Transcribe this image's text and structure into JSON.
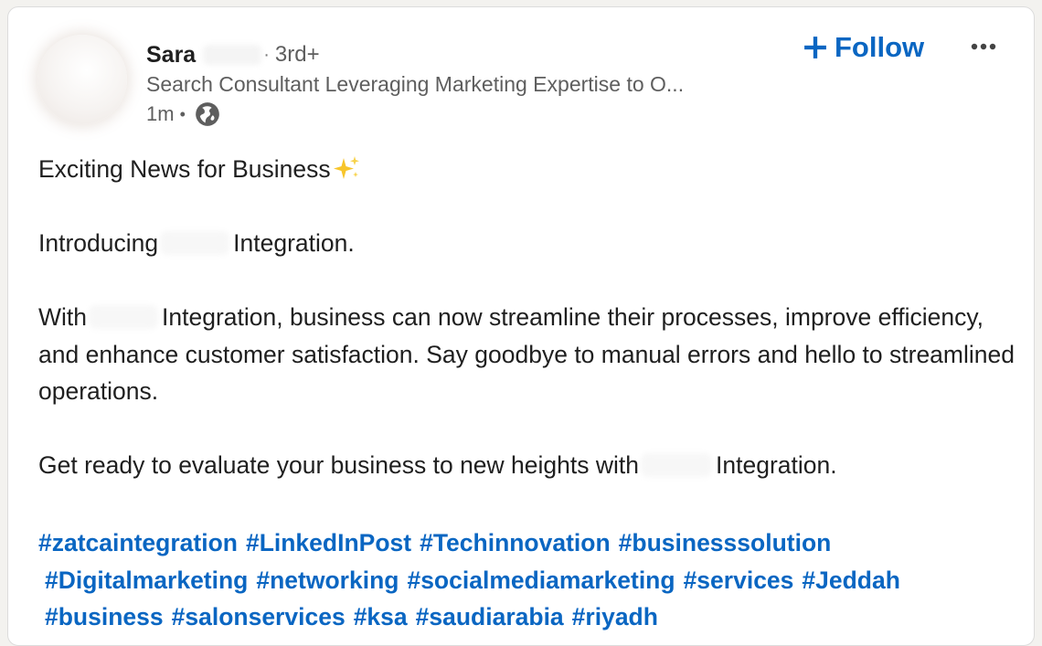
{
  "author": {
    "name": "Sara",
    "degree": "3rd+",
    "headline": "Search Consultant Leveraging Marketing Expertise to O...",
    "time": "1m",
    "visibility_icon": "globe-icon"
  },
  "actions": {
    "follow_label": "Follow",
    "follow_icon": "plus-icon",
    "more_icon": "more-options-icon"
  },
  "post": {
    "title": "Exciting News for Business",
    "title_emoji": "sparkles-icon",
    "intro_before": "Introducing",
    "intro_after": "Integration.",
    "p2_before": "With",
    "p2_after": "Integration, business can now streamline their processes, improve efficiency, and enhance customer satisfaction. Say goodbye to manual errors and hello to streamlined operations.",
    "p3_before": "Get ready to evaluate your business to new heights with",
    "p3_after": "Integration."
  },
  "hashtags": {
    "line1": [
      "#zatcaintegration",
      "#LinkedInPost",
      "#Techinnovation",
      "#businesssolution"
    ],
    "line2": [
      "#Digitalmarketing",
      "#networking",
      "#socialmediamarketing",
      "#services",
      "#Jeddah"
    ],
    "line3": [
      "#business",
      "#salonservices",
      "#ksa",
      "#saudiarabia",
      "#riyadh"
    ]
  },
  "colors": {
    "link_blue": "#0a66c2",
    "text_primary": "#1f1f1f",
    "text_secondary": "#5e5e5e",
    "sparkle_gold": "#f7c52b"
  }
}
